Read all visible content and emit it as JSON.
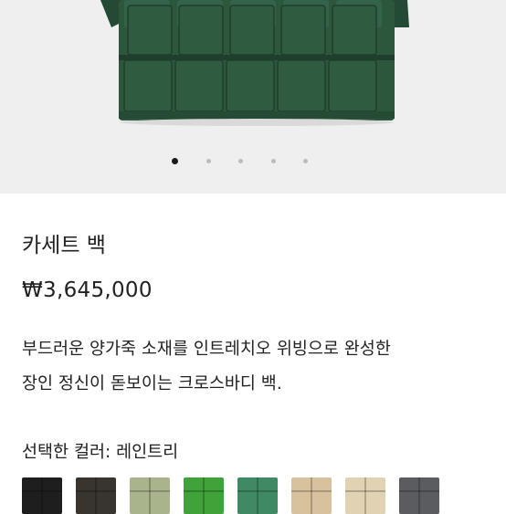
{
  "product": {
    "title": "카세트 백",
    "price": "₩3,645,000",
    "description_line1": "부드러운 양가죽 소재를 인트레치오 위빙으로 완성한",
    "description_line2": "장인 정신이 돋보이는 크로스바디 백.",
    "selected_color_label": "선택한 컬러: 레인트리"
  },
  "carousel": {
    "total": 5,
    "active_index": 0
  },
  "colors": {
    "bag_main": "#2f5c40",
    "bag_dark": "#1f3f2c",
    "hero_bg": "#efefef"
  },
  "swatches": [
    {
      "name": "black",
      "color": "#1e1e1e"
    },
    {
      "name": "dark-brown",
      "color": "#3a342e"
    },
    {
      "name": "sage",
      "color": "#a9b48c"
    },
    {
      "name": "green",
      "color": "#3fa33a"
    },
    {
      "name": "raintree",
      "color": "#3f8a64"
    },
    {
      "name": "beige",
      "color": "#d8c29d"
    },
    {
      "name": "light-beige",
      "color": "#e2d2b4"
    },
    {
      "name": "charcoal",
      "color": "#5a5c60"
    }
  ]
}
